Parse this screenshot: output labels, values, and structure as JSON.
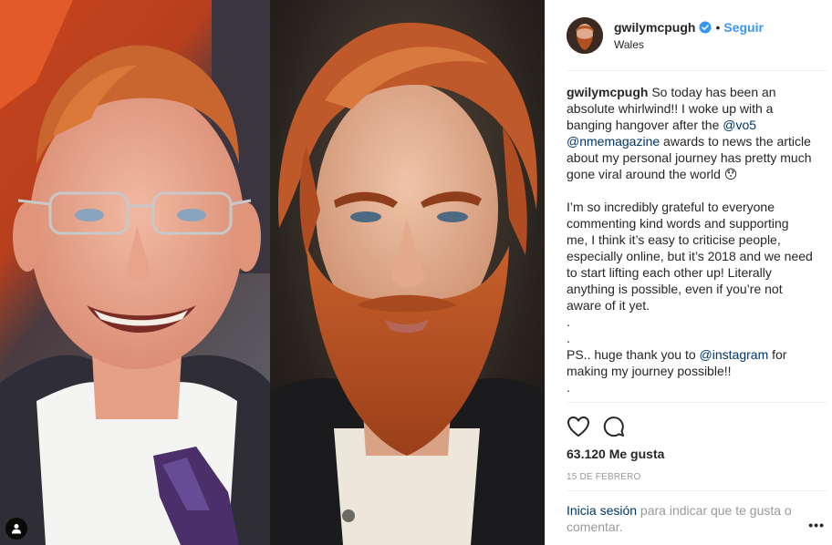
{
  "post": {
    "username": "gwilymcpugh",
    "verified": true,
    "follow_label": "Seguir",
    "location": "Wales",
    "caption": {
      "username": "gwilymcpugh",
      "part1": " So today has been an absolute whirlwind!! I woke up with a banging hangover after the ",
      "mention1": "@vo5",
      "space": " ",
      "mention2": "@nmemagazine",
      "part2": " awards to news the article about my personal journey has pretty much gone viral around the world 😯",
      "para2": "I’m so incredibly grateful to everyone commenting kind words and supporting me, I think it’s easy to criticise people, especially online, but it’s 2018 and we need to start lifting each other up! Literally anything is possible, even if you’re not aware of it yet.",
      "dot1": ".",
      "dot2": ".",
      "ps_prefix": "PS.. huge thank you to ",
      "mention3": "@instagram",
      "ps_suffix": " for making my journey possible!!",
      "dot3": "."
    },
    "likes": "63.120 Me gusta",
    "date": "15 DE FEBRERO",
    "login_link": "Inicia sesión",
    "login_rest": " para indicar que te gusta o comentar.",
    "more_label": "•••"
  },
  "icons": {
    "verified": "verified-badge-icon",
    "like": "heart-icon",
    "comment": "comment-bubble-icon",
    "tag": "user-tag-icon"
  },
  "colors": {
    "accent": "#3897f0",
    "mention": "#003569",
    "muted": "#999999",
    "text": "#262626"
  }
}
